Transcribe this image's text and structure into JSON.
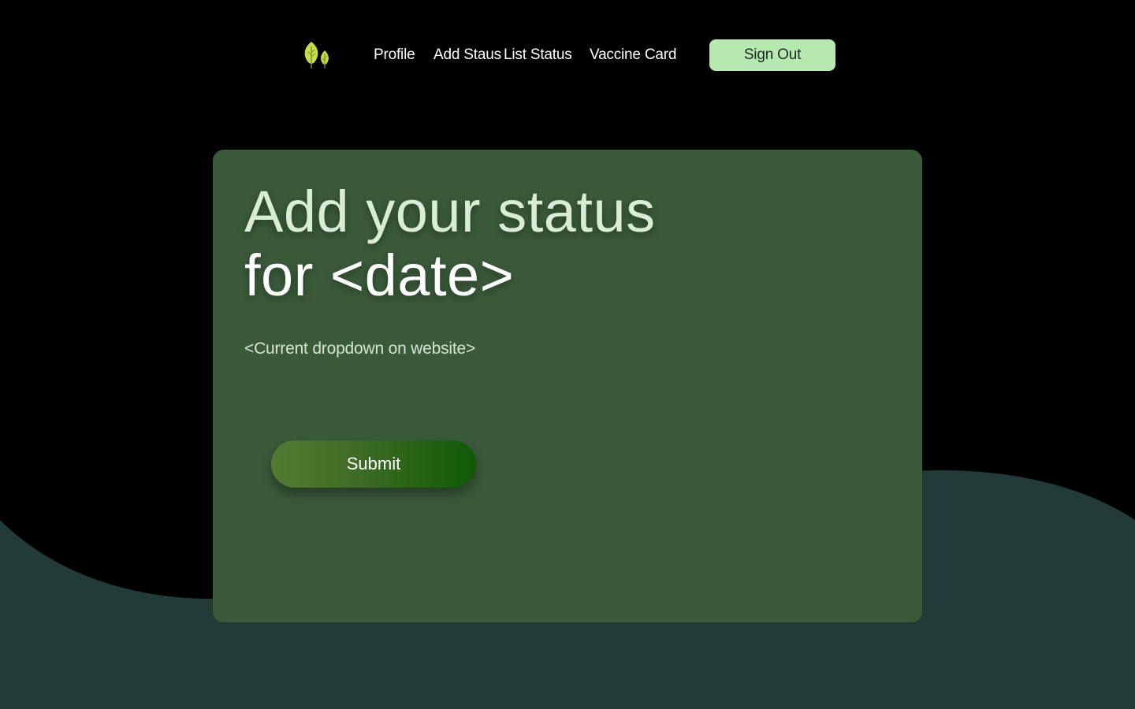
{
  "nav": {
    "links": [
      {
        "label": "Profile"
      },
      {
        "label": "Add Staus"
      },
      {
        "label": "List Status"
      },
      {
        "label": "Vaccine Card"
      }
    ],
    "signout_label": "Sign Out",
    "logo_icon": "leaf-icon"
  },
  "card": {
    "heading_line1": "Add your status",
    "heading_line2": "for <date>",
    "dropdown_text": "<Current dropdown on website>",
    "submit_label": "Submit"
  },
  "colors": {
    "background": "#000000",
    "wave": "#223b36",
    "card": "#3a5a3a",
    "signout_button": "#b8e8b2",
    "submit_gradient_start": "#547a32",
    "submit_gradient_end": "#0f5a06",
    "logo_leaf": "#c8dc4a"
  }
}
